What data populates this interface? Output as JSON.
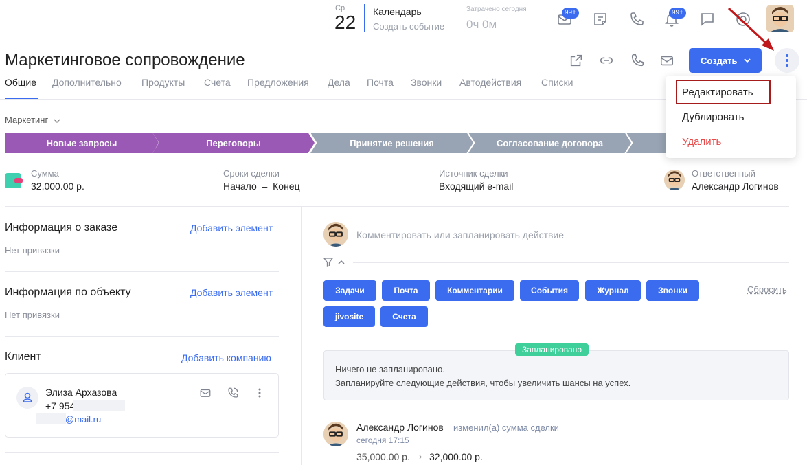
{
  "topbar": {
    "date": {
      "dow": "Ср",
      "day": "22"
    },
    "calendar": {
      "title": "Календарь",
      "create": "Создать событие"
    },
    "spent": {
      "label": "Затрачено сегодня",
      "value": "0ч 0м"
    },
    "icons": [
      {
        "name": "mail-icon",
        "badge": "99+"
      },
      {
        "name": "notes-icon"
      },
      {
        "name": "phone-icon"
      },
      {
        "name": "bell-icon",
        "badge": "99+"
      },
      {
        "name": "chat-icon"
      },
      {
        "name": "help-icon"
      }
    ]
  },
  "header": {
    "title": "Маркетинговое сопровождение",
    "create_label": "Создать",
    "icons": [
      "external-link-icon",
      "link-icon",
      "phone-icon",
      "mail-icon"
    ]
  },
  "tabs": [
    "Общие",
    "Дополнительно",
    "Продукты",
    "Счета",
    "Предложения",
    "Дела",
    "Почта",
    "Звонки",
    "Автодействия",
    "Списки"
  ],
  "pipeline": {
    "label": "Маркетинг",
    "stages": [
      {
        "label": "Новые запросы",
        "color": "#9b59b6",
        "active": true
      },
      {
        "label": "Переговоры",
        "color": "#9b59b6",
        "active": true
      },
      {
        "label": "Принятие решения",
        "color": "#98a3b3",
        "active": false
      },
      {
        "label": "Согласование договора",
        "color": "#98a3b3",
        "active": false
      },
      {
        "label": "",
        "color": "#98a3b3",
        "active": false
      }
    ]
  },
  "summary": {
    "amount_label": "Сумма",
    "amount_value": "32,000.00 р.",
    "terms_label": "Сроки сделки",
    "terms_value": "Начало  –  Конец",
    "source_label": "Источник сделки",
    "source_value": "Входящий e-mail",
    "owner_label": "Ответственный",
    "owner_value": "Александр Логинов"
  },
  "left": {
    "order": {
      "title": "Информация о заказе",
      "link": "Добавить элемент",
      "note": "Нет привязки"
    },
    "object": {
      "title": "Информация по объекту",
      "link": "Добавить элемент",
      "note": "Нет привязки"
    },
    "client": {
      "title": "Клиент",
      "link": "Добавить компанию",
      "name": "Элиза Архазова",
      "phone": "+7 954",
      "email": "@mail.ru"
    }
  },
  "right": {
    "comment_placeholder": "Комментировать или запланировать действие",
    "filters": [
      "Задачи",
      "Почта",
      "Комментарии",
      "События",
      "Журнал",
      "Звонки",
      "jivosite",
      "Счета"
    ],
    "reset": "Сбросить",
    "planned_badge": "Запланировано",
    "planned_line1": "Ничего не запланировано.",
    "planned_line2": "Запланируйте следующие действия, чтобы увеличить шансы на успех.",
    "activity": {
      "author": "Александр Логинов",
      "action": "изменил(а) сумма сделки",
      "time": "сегодня 17:15",
      "old_value": "35,000.00 р.",
      "new_value": "32,000.00 р."
    }
  },
  "menu": {
    "items": [
      {
        "label": "Редактировать",
        "danger": false
      },
      {
        "label": "Дублировать",
        "danger": false
      },
      {
        "label": "Удалить",
        "danger": true
      }
    ]
  },
  "colors": {
    "accent": "#3b6cf0",
    "danger": "#e84a4a",
    "success": "#3ecf9a",
    "pipeline_active": "#9b59b6",
    "pipeline_inactive": "#98a3b3",
    "annotation": "#a61b1b"
  }
}
